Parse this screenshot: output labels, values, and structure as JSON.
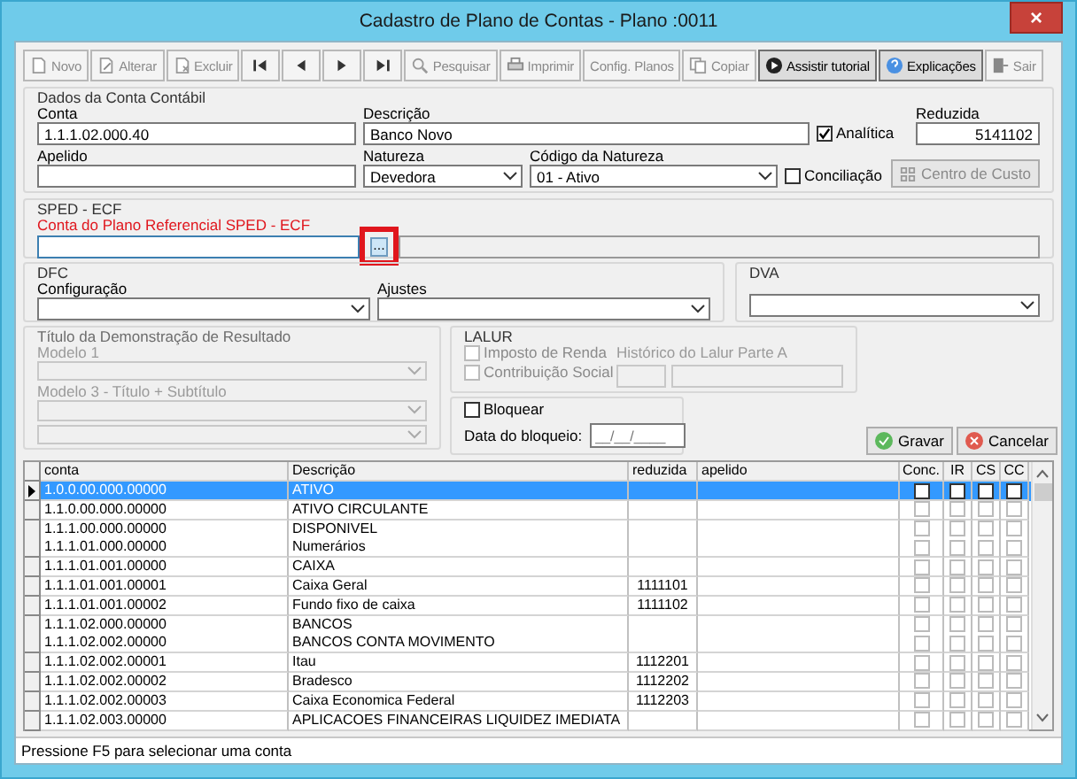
{
  "window": {
    "title": "Cadastro de Plano de Contas - Plano :0011",
    "close": "×"
  },
  "toolbar": [
    {
      "label": "Novo",
      "kind": "new",
      "disabled": true
    },
    {
      "label": "Alterar",
      "kind": "edit",
      "disabled": true
    },
    {
      "label": "Excluir",
      "kind": "delete",
      "disabled": true
    },
    {
      "kind": "first",
      "disabled": false
    },
    {
      "kind": "prev",
      "disabled": false
    },
    {
      "kind": "next",
      "disabled": false
    },
    {
      "kind": "last",
      "disabled": false
    },
    {
      "label": "Pesquisar",
      "kind": "search",
      "disabled": true
    },
    {
      "label": "Imprimir",
      "kind": "print",
      "disabled": true
    },
    {
      "label": "Config. Planos",
      "kind": "text",
      "disabled": true
    },
    {
      "label": "Copiar",
      "kind": "copy",
      "disabled": true
    },
    {
      "label": "Assistir tutorial",
      "kind": "play",
      "disabled": false
    },
    {
      "label": "Explicações",
      "kind": "help",
      "disabled": false
    },
    {
      "label": "Sair",
      "kind": "exit",
      "disabled": true
    }
  ],
  "dados": {
    "title": "Dados da Conta Contábil",
    "conta": {
      "label": "Conta",
      "value": "1.1.1.02.000.40"
    },
    "descricao": {
      "label": "Descrição",
      "value": "Banco Novo"
    },
    "analitica": {
      "label": "Analítica",
      "checked": true
    },
    "reduzida": {
      "label": "Reduzida",
      "value": "5141102"
    },
    "apelido": {
      "label": "Apelido"
    },
    "natureza": {
      "label": "Natureza",
      "value": "Devedora"
    },
    "codigo_natureza": {
      "label": "Código da Natureza",
      "value": "01 - Ativo"
    },
    "conciliacao": {
      "label": "Conciliação",
      "checked": false
    },
    "centro_custo": {
      "label": "Centro de Custo",
      "disabled": true
    }
  },
  "sped": {
    "title": "SPED - ECF",
    "label": "Conta do Plano Referencial SPED - ECF",
    "browse": "...",
    "highlighted": true
  },
  "dfc": {
    "title": "DFC",
    "configuracao": "Configuração",
    "ajustes": "Ajustes"
  },
  "dva": {
    "title": "DVA"
  },
  "resultado": {
    "title": "Título da Demonstração de Resultado",
    "modelo1": "Modelo 1",
    "modelo3": "Modelo 3 - Título + Subtítulo",
    "disabled": true
  },
  "lalur": {
    "title": "LALUR",
    "imposto": {
      "label": "Imposto de Renda",
      "checked": false
    },
    "contribuicao": {
      "label": "Contribuição Social",
      "checked": false
    },
    "historico": "Histórico do Lalur Parte A",
    "disabled": true
  },
  "bloqueio": {
    "bloquear": {
      "label": "Bloquear",
      "checked": false
    },
    "data_label": "Data do bloqueio:",
    "data_placeholder": "__/__/____"
  },
  "actions": [
    {
      "label": "Gravar",
      "kind": "save"
    },
    {
      "label": "Cancelar",
      "kind": "cancel"
    }
  ],
  "grid": {
    "columns": [
      "conta",
      "Descrição",
      "reduzida",
      "apelido",
      "Conc.",
      "IR",
      "CS",
      "CC"
    ],
    "rows": [
      {
        "conta": "1.0.0.00.000.00000",
        "descricao": "ATIVO",
        "selected": true,
        "conc": false,
        "ir": false,
        "cs": false,
        "cc": false
      },
      {
        "conta": "1.1.0.00.000.00000",
        "descricao": "ATIVO CIRCULANTE",
        "selected": false,
        "conc": false,
        "ir": false,
        "cs": false,
        "cc": false
      },
      {
        "conta": "1.1.1.00.000.00000",
        "descricao": "DISPONIVEL",
        "selected": false,
        "conc": false,
        "ir": false,
        "cs": false,
        "cc": false
      },
      {
        "conta": "1.1.1.01.000.00000",
        "descricao": "Numerários",
        "selected": false,
        "conc": false,
        "ir": false,
        "cs": false,
        "cc": false
      },
      {
        "conta": "1.1.1.01.001.00000",
        "descricao": "CAIXA",
        "selected": false,
        "conc": false,
        "ir": false,
        "cs": false,
        "cc": false
      },
      {
        "conta": "1.1.1.01.001.00001",
        "descricao": "Caixa Geral",
        "reduzida": "1111101",
        "selected": false,
        "conc": false,
        "ir": false,
        "cs": false,
        "cc": false
      },
      {
        "conta": "1.1.1.01.001.00002",
        "descricao": "Fundo fixo de caixa",
        "reduzida": "1111102",
        "selected": false,
        "conc": false,
        "ir": false,
        "cs": false,
        "cc": false
      },
      {
        "conta": "1.1.1.02.000.00000",
        "descricao": "BANCOS",
        "selected": false,
        "conc": false,
        "ir": false,
        "cs": false,
        "cc": false
      },
      {
        "conta": "1.1.1.02.002.00000",
        "descricao": "BANCOS CONTA MOVIMENTO",
        "selected": false,
        "conc": false,
        "ir": false,
        "cs": false,
        "cc": false
      },
      {
        "conta": "1.1.1.02.002.00001",
        "descricao": "Itau",
        "reduzida": "1112201",
        "selected": false,
        "conc": false,
        "ir": false,
        "cs": false,
        "cc": false
      },
      {
        "conta": "1.1.1.02.002.00002",
        "descricao": "Bradesco",
        "reduzida": "1112202",
        "selected": false,
        "conc": false,
        "ir": false,
        "cs": false,
        "cc": false
      },
      {
        "conta": "1.1.1.02.002.00003",
        "descricao": "Caixa Economica Federal",
        "reduzida": "1112203",
        "selected": false,
        "conc": false,
        "ir": false,
        "cs": false,
        "cc": false
      },
      {
        "conta": "1.1.1.02.003.00000",
        "descricao": "APLICACOES FINANCEIRAS LIQUIDEZ IMEDIATA",
        "selected": false,
        "conc": false,
        "ir": false,
        "cs": false,
        "cc": false
      }
    ]
  },
  "status_bar": "Pressione F5 para selecionar uma conta"
}
